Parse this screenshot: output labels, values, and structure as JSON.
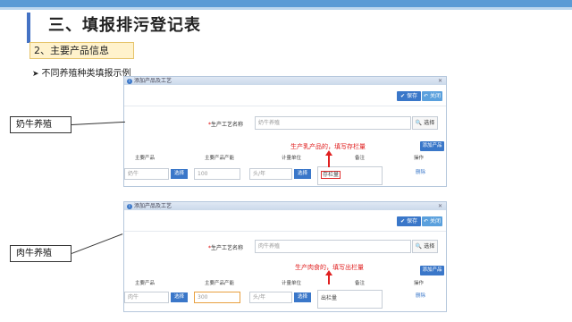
{
  "slide": {
    "title": "三、填报排污登记表",
    "section": "2、主要产品信息",
    "bullet": "不同养殖种类填报示例"
  },
  "dialog_title": "添加产品及工艺",
  "toolbar": {
    "save_label": "保存",
    "close_label": "关闭"
  },
  "process_label": "生产工艺名称",
  "select_label": "选择",
  "add_product_label": "添加产品",
  "columns": [
    "主要产品",
    "主要产品产能",
    "计量单位",
    "备注",
    "操作"
  ],
  "examples": [
    {
      "callout": "奶牛养殖",
      "process_placeholder": "奶牛养殖",
      "annotation": "生产乳产品的，填写存栏量",
      "product": "奶牛",
      "capacity": "100",
      "unit": "头/年",
      "remark": "存栏量",
      "action": "删除"
    },
    {
      "callout": "肉牛养殖",
      "process_placeholder": "肉牛养殖",
      "annotation": "生产肉食的，填写出栏量",
      "product": "肉牛",
      "capacity": "300",
      "unit": "头/年",
      "remark": "出栏量",
      "action": "删除"
    }
  ]
}
